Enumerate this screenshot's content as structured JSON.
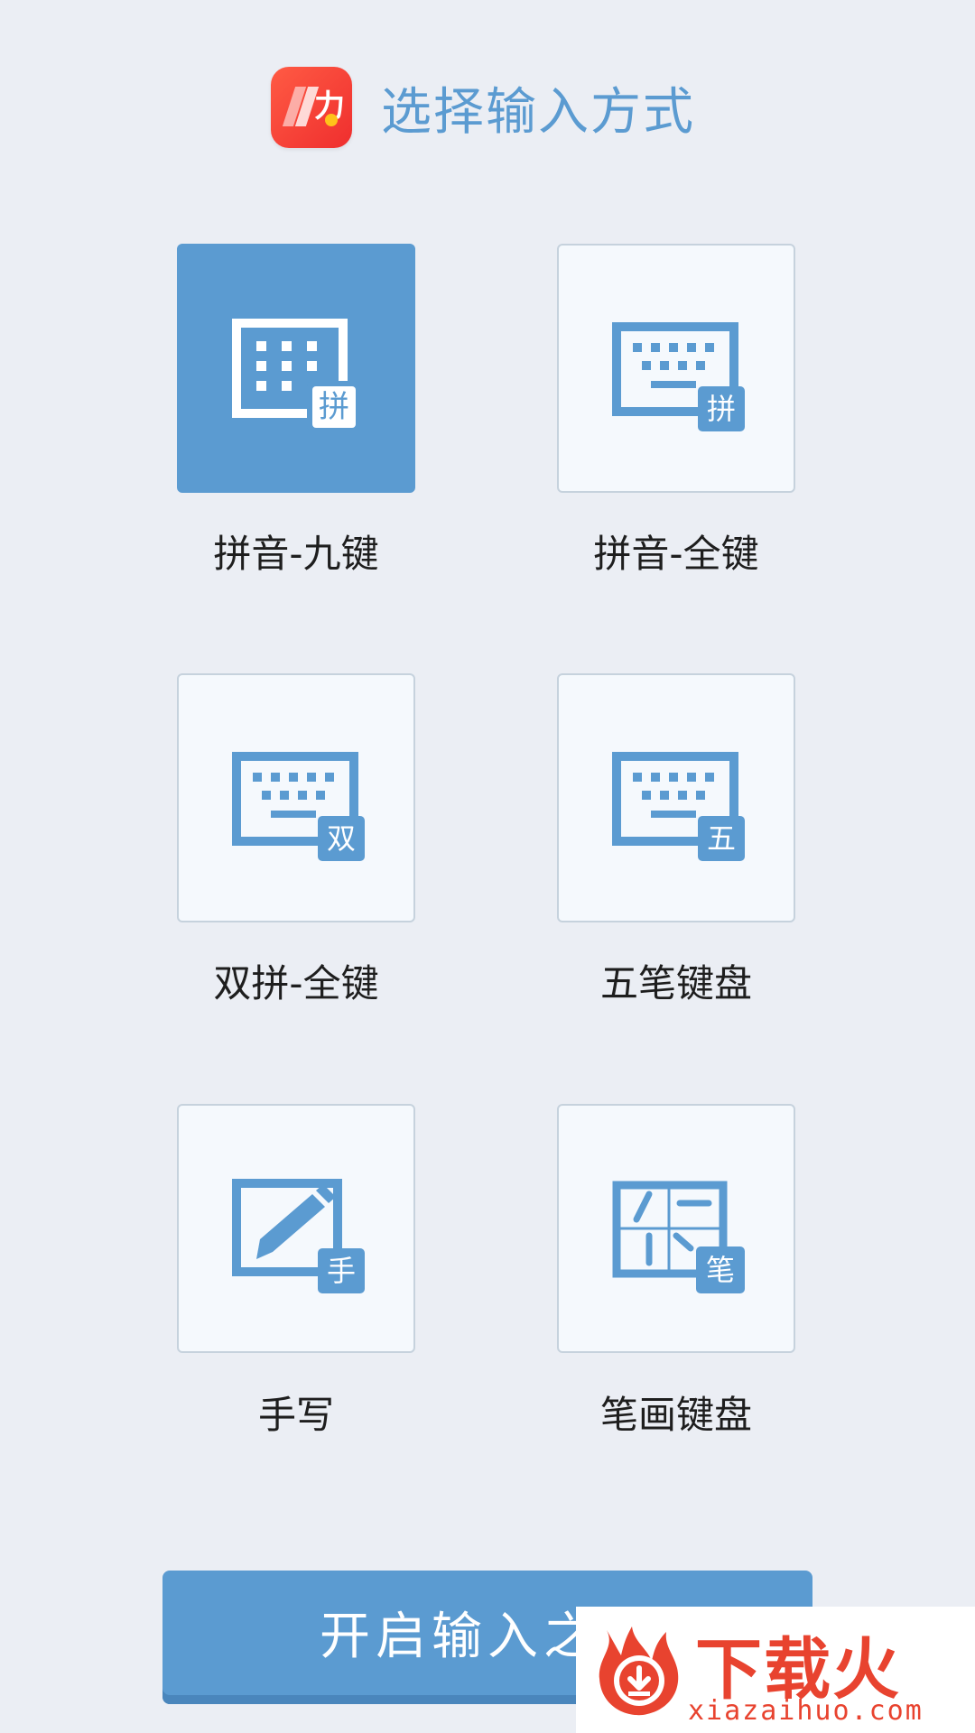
{
  "header": {
    "title": "选择输入方式",
    "app_logo_glyph": "力"
  },
  "input_methods": [
    {
      "label": "拼音-九键",
      "badge": "拼",
      "selected": true
    },
    {
      "label": "拼音-全键",
      "badge": "拼",
      "selected": false
    },
    {
      "label": "双拼-全键",
      "badge": "双",
      "selected": false
    },
    {
      "label": "五笔键盘",
      "badge": "五",
      "selected": false
    },
    {
      "label": "手写",
      "badge": "手",
      "selected": false
    },
    {
      "label": "笔画键盘",
      "badge": "笔",
      "selected": false
    }
  ],
  "start_button": {
    "label": "开启输入之旅"
  },
  "watermark": {
    "text": "下载火",
    "url": "xiazaihuo.com"
  },
  "colors": {
    "accent": "#5b9bd1",
    "background": "#ebeef4",
    "card_bg": "#f5f9fd",
    "watermark": "#e8432f"
  }
}
